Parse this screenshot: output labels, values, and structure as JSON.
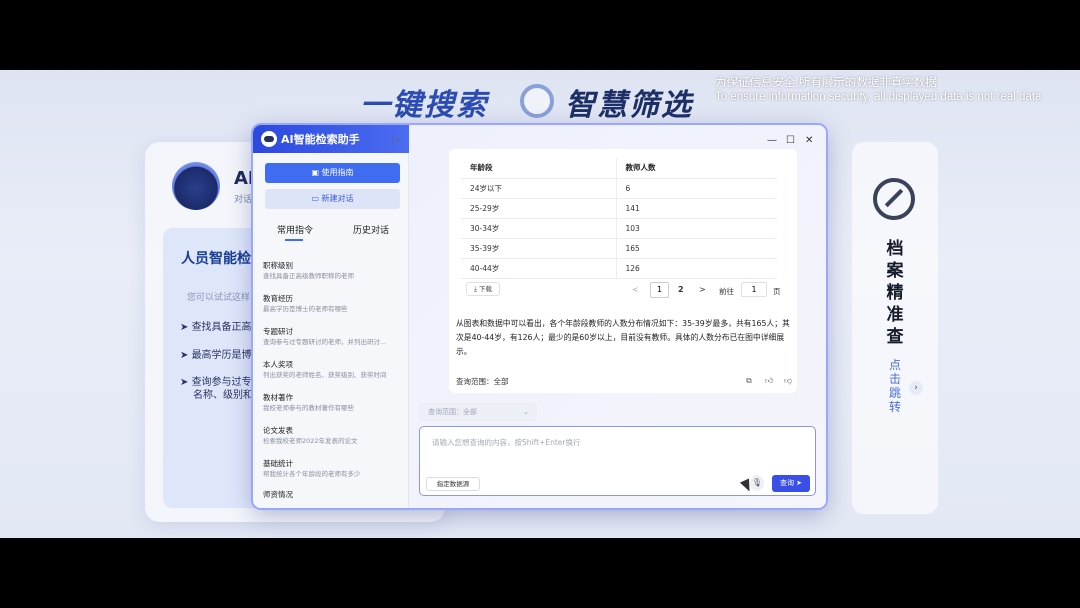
{
  "background": {
    "heading_left": "一键搜索",
    "heading_right": "智慧筛选",
    "left_card": {
      "title": "AI",
      "subtitle": "对话",
      "inner_title": "人员智能检",
      "hint": "您可以试试这样",
      "bullets": [
        "查找具备正高",
        "最高学历是博",
        "查询参与过专",
        "名称、级别和"
      ]
    },
    "right_card": {
      "title_chars": [
        "档",
        "案",
        "精",
        "准",
        "查"
      ],
      "link_chars": [
        "点",
        "击",
        "跳",
        "转"
      ]
    }
  },
  "notice": {
    "zh": "为保证信息安全,所有展示的数据非真实数据",
    "en": "To ensure information security, all displayed data is not real data"
  },
  "app": {
    "title": "AI智能检索助手",
    "guide_button": "使用指南",
    "new_chat_button": "新建对话",
    "tabs": [
      "常用指令",
      "历史对话"
    ],
    "commands": [
      {
        "title": "职称级别",
        "desc": "查找具备正高级教师职称的老师"
      },
      {
        "title": "教育经历",
        "desc": "最高学历是博士的老师有哪些"
      },
      {
        "title": "专题研讨",
        "desc": "查询参与过专题研讨的老师，并列出研讨..."
      },
      {
        "title": "本人奖项",
        "desc": "列出获奖的老师姓名、获奖级别、获奖时间"
      },
      {
        "title": "教材著作",
        "desc": "我校老师参与的教材著作有哪些"
      },
      {
        "title": "论文发表",
        "desc": "检索我校老师2022年发表的论文"
      },
      {
        "title": "基础统计",
        "desc": "帮我统计各个年龄段的老师有多少"
      },
      {
        "title": "师资情况",
        "desc": ""
      }
    ]
  },
  "result": {
    "columns": [
      "年龄段",
      "教师人数"
    ],
    "rows": [
      [
        "24岁以下",
        "6"
      ],
      [
        "25-29岁",
        "141"
      ],
      [
        "30-34岁",
        "103"
      ],
      [
        "35-39岁",
        "165"
      ],
      [
        "40-44岁",
        "126"
      ]
    ],
    "download": "下载",
    "pagination": {
      "prev": "<",
      "page1": "1",
      "page2": "2",
      "next": ">",
      "goto": "前往",
      "goto_value": "1",
      "page_suffix": "页"
    },
    "answer": "从图表和数据中可以看出，各个年龄段教师的人数分布情况如下：35-39岁最多，共有165人；其次是40-44岁，有126人；最少的是60岁以上，目前没有教师。具体的人数分布已在图中详细展示。",
    "scope": "查询范围：全部"
  },
  "composer": {
    "scope_select": "查询范围：全部",
    "placeholder": "请输入您想查询的内容，按Shift+Enter换行",
    "source_button": "指定数据源",
    "send_button": "查询 ➤"
  }
}
